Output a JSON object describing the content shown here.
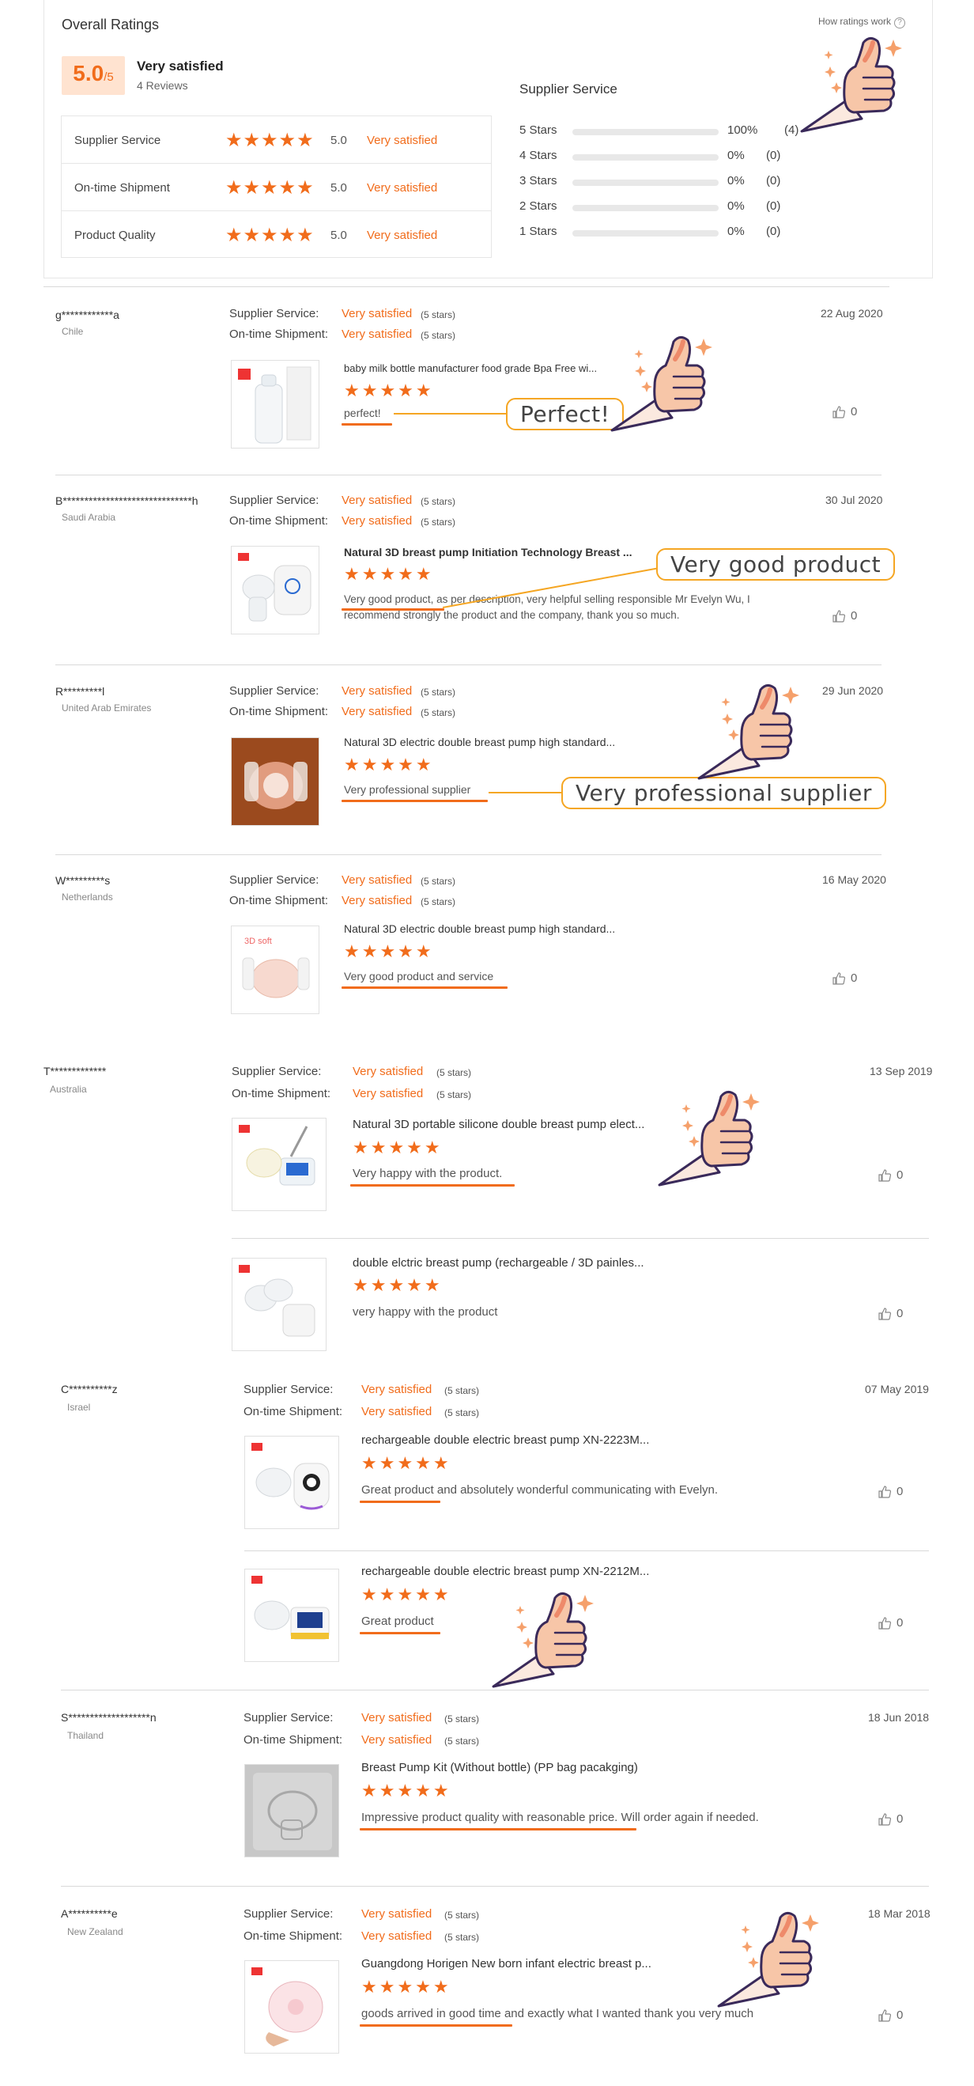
{
  "overall": {
    "title": "Overall Ratings",
    "how_link": "How ratings work",
    "score": "5.0",
    "score_suffix": "/5",
    "verdict": "Very satisfied",
    "review_count": "4 Reviews",
    "rows": [
      {
        "label": "Supplier Service",
        "value": "5.0",
        "text": "Very satisfied"
      },
      {
        "label": "On-time Shipment",
        "value": "5.0",
        "text": "Very satisfied"
      },
      {
        "label": "Product Quality",
        "value": "5.0",
        "text": "Very satisfied"
      }
    ],
    "breakdown_title": "Supplier Service",
    "breakdown": [
      {
        "label": "5 Stars",
        "percent": "100%",
        "count": "(4)",
        "fill": 1.0
      },
      {
        "label": "4 Stars",
        "percent": "0%",
        "count": "(0)",
        "fill": 0
      },
      {
        "label": "3 Stars",
        "percent": "0%",
        "count": "(0)",
        "fill": 0
      },
      {
        "label": "2 Stars",
        "percent": "0%",
        "count": "(0)",
        "fill": 0
      },
      {
        "label": "1 Stars",
        "percent": "0%",
        "count": "(0)",
        "fill": 0
      }
    ]
  },
  "labels": {
    "supplier_service": "Supplier Service:",
    "on_time_shipment": "On-time Shipment:",
    "very_satisfied": "Very satisfied",
    "five_stars": "(5 stars)",
    "stars": "★★★★★"
  },
  "callouts": [
    "Perfect!",
    "Very good product",
    "Very professional supplier"
  ],
  "reviews": [
    {
      "user": "g************a",
      "country": "Chile",
      "date": "22 Aug 2020",
      "items": [
        {
          "title": "baby milk bottle manufacturer food grade Bpa Free wi...",
          "comment": "perfect!",
          "likes": "0"
        }
      ]
    },
    {
      "user": "B******************************h",
      "country": "Saudi Arabia",
      "date": "30 Jul 2020",
      "items": [
        {
          "title": "Natural 3D breast pump Initiation Technology Breast ...",
          "comment": "Very good product, as per description,  very helpful selling responsible Mr Evelyn Wu, I recommend strongly the product and the company, thank you so much.",
          "likes": "0"
        }
      ]
    },
    {
      "user": "R*********l",
      "country": "United Arab Emirates",
      "date": "29 Jun 2020",
      "items": [
        {
          "title": "Natural 3D electric double breast pump high standard...",
          "comment": "Very professional supplier",
          "likes": ""
        }
      ]
    },
    {
      "user": "W*********s",
      "country": "Netherlands",
      "date": "16 May 2020",
      "items": [
        {
          "title": "Natural 3D electric double breast pump high standard...",
          "comment": "Very good product and service",
          "likes": "0"
        }
      ]
    },
    {
      "user": "T*************",
      "country": "Australia",
      "date": "13 Sep 2019",
      "items": [
        {
          "title": "Natural 3D portable silicone double breast pump elect...",
          "comment": "Very happy with the product.",
          "likes": "0"
        },
        {
          "title": "double elctric breast pump (rechargeable / 3D painles...",
          "comment": "very happy with the product",
          "likes": "0"
        }
      ]
    },
    {
      "user": "C**********z",
      "country": "Israel",
      "date": "07 May 2019",
      "items": [
        {
          "title": "rechargeable double electric breast pump XN-2223M...",
          "comment": "Great product  and absolutely wonderful communicating with Evelyn.",
          "likes": "0"
        },
        {
          "title": "rechargeable double electric breast pump XN-2212M...",
          "comment": "Great product",
          "likes": "0"
        }
      ]
    },
    {
      "user": "S*******************n",
      "country": "Thailand",
      "date": "18 Jun 2018",
      "items": [
        {
          "title": "Breast Pump Kit (Without bottle) (PP bag pacakging)",
          "comment": "Impressive product quality with reasonable price. Will order again if needed.",
          "likes": "0"
        }
      ]
    },
    {
      "user": "A**********e",
      "country": "New Zealand",
      "date": "18 Mar 2018",
      "items": [
        {
          "title": "Guangdong Horigen New born infant electric breast p...",
          "comment": "goods arrived in good time and exactly what I wanted thank you very much",
          "likes": "0"
        }
      ]
    }
  ],
  "colors": {
    "accent": "#f16c1b",
    "callout_border": "#f5a623",
    "score_bg": "#ffe3d0"
  }
}
